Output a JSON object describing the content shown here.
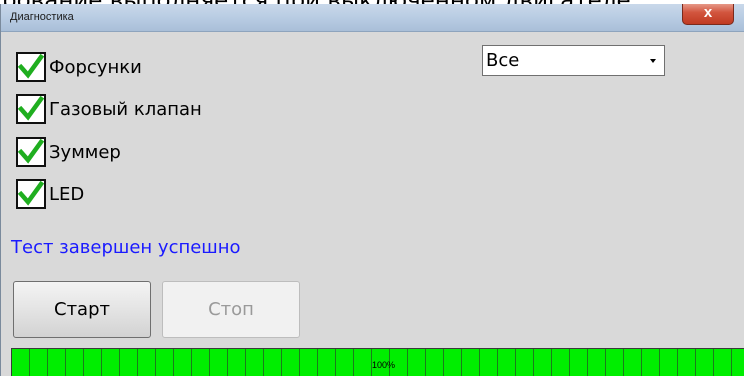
{
  "background_caption": "рование выполняется при выключенном двигателе.",
  "window": {
    "title": "Диагностика",
    "close_glyph": "x"
  },
  "checkboxes": [
    {
      "label": "Форсунки",
      "checked": true
    },
    {
      "label": "Газовый клапан",
      "checked": true
    },
    {
      "label": "Зуммер",
      "checked": true
    },
    {
      "label": "LED",
      "checked": true
    }
  ],
  "select": {
    "value": "Все"
  },
  "status": {
    "text": "Тест завершен успешно",
    "color": "#1a1aff"
  },
  "buttons": {
    "start": "Старт",
    "stop": "Стоп",
    "stop_enabled": false
  },
  "progress": {
    "value": 1.0,
    "text": "100%",
    "color": "#00ee00"
  },
  "icons": {
    "check": "green-checkmark-icon",
    "dropdown": "chevron-down-icon",
    "close": "close-icon"
  }
}
